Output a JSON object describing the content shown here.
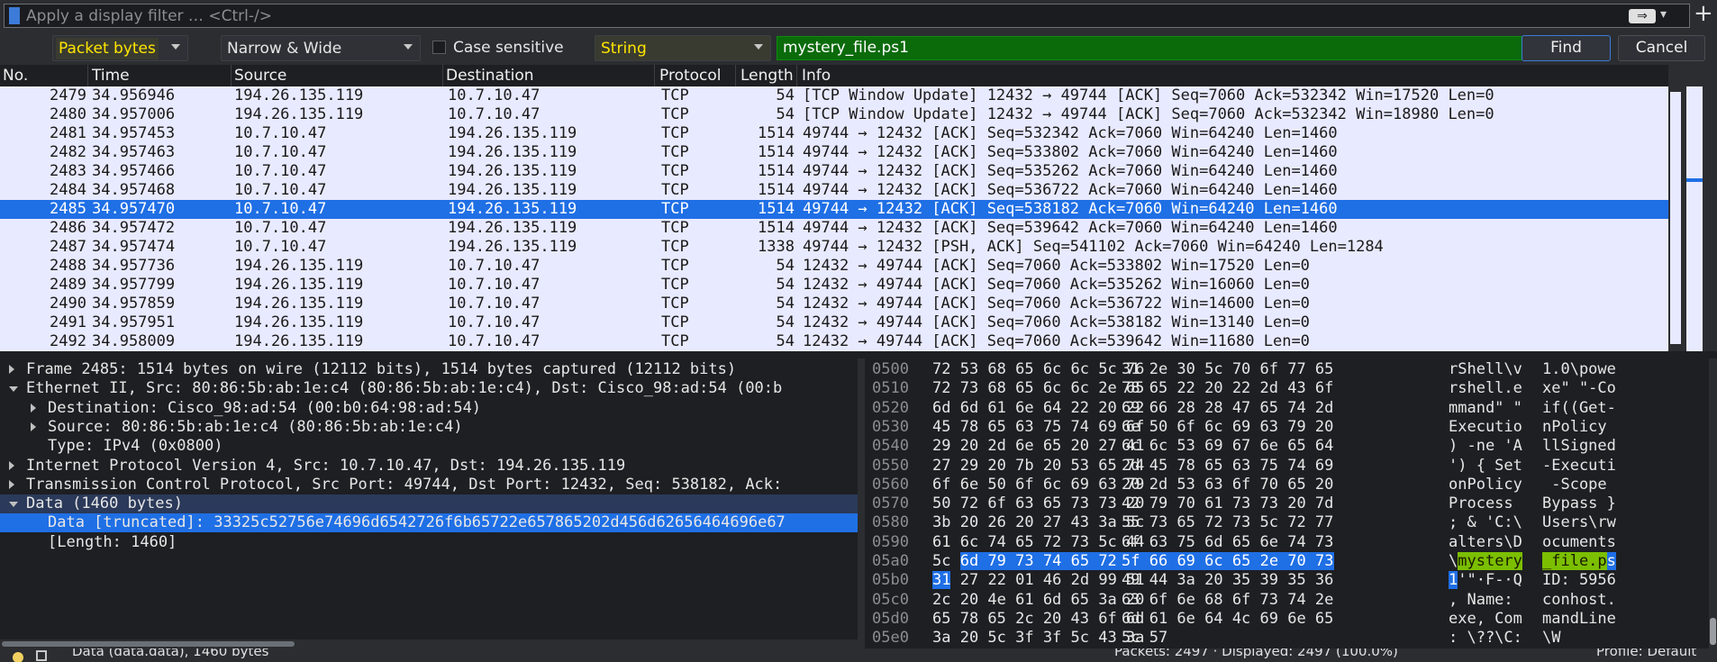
{
  "filter_bar": {
    "placeholder": "Apply a display filter … <Ctrl-/>",
    "apply_icon": "arrow-right-icon",
    "plus_label": "+"
  },
  "find_bar": {
    "search_in": "Packet bytes",
    "char_width": "Narrow & Wide",
    "case_sensitive_label": "Case sensitive",
    "case_sensitive_checked": false,
    "search_type": "String",
    "search_value": "mystery_file.ps1",
    "find_label": "Find",
    "cancel_label": "Cancel"
  },
  "packet_list": {
    "columns": [
      "No.",
      "Time",
      "Source",
      "Destination",
      "Protocol",
      "Length",
      "Info"
    ],
    "selected_index": 6,
    "rows": [
      {
        "no": "2479",
        "time": "34.956946",
        "src": "194.26.135.119",
        "dst": "10.7.10.47",
        "proto": "TCP",
        "len": "54",
        "info": "[TCP Window Update] 12432 → 49744 [ACK] Seq=7060 Ack=532342 Win=17520 Len=0"
      },
      {
        "no": "2480",
        "time": "34.957006",
        "src": "194.26.135.119",
        "dst": "10.7.10.47",
        "proto": "TCP",
        "len": "54",
        "info": "[TCP Window Update] 12432 → 49744 [ACK] Seq=7060 Ack=532342 Win=18980 Len=0"
      },
      {
        "no": "2481",
        "time": "34.957453",
        "src": "10.7.10.47",
        "dst": "194.26.135.119",
        "proto": "TCP",
        "len": "1514",
        "info": "49744 → 12432 [ACK] Seq=532342 Ack=7060 Win=64240 Len=1460"
      },
      {
        "no": "2482",
        "time": "34.957463",
        "src": "10.7.10.47",
        "dst": "194.26.135.119",
        "proto": "TCP",
        "len": "1514",
        "info": "49744 → 12432 [ACK] Seq=533802 Ack=7060 Win=64240 Len=1460"
      },
      {
        "no": "2483",
        "time": "34.957466",
        "src": "10.7.10.47",
        "dst": "194.26.135.119",
        "proto": "TCP",
        "len": "1514",
        "info": "49744 → 12432 [ACK] Seq=535262 Ack=7060 Win=64240 Len=1460"
      },
      {
        "no": "2484",
        "time": "34.957468",
        "src": "10.7.10.47",
        "dst": "194.26.135.119",
        "proto": "TCP",
        "len": "1514",
        "info": "49744 → 12432 [ACK] Seq=536722 Ack=7060 Win=64240 Len=1460"
      },
      {
        "no": "2485",
        "time": "34.957470",
        "src": "10.7.10.47",
        "dst": "194.26.135.119",
        "proto": "TCP",
        "len": "1514",
        "info": "49744 → 12432 [ACK] Seq=538182 Ack=7060 Win=64240 Len=1460"
      },
      {
        "no": "2486",
        "time": "34.957472",
        "src": "10.7.10.47",
        "dst": "194.26.135.119",
        "proto": "TCP",
        "len": "1514",
        "info": "49744 → 12432 [ACK] Seq=539642 Ack=7060 Win=64240 Len=1460"
      },
      {
        "no": "2487",
        "time": "34.957474",
        "src": "10.7.10.47",
        "dst": "194.26.135.119",
        "proto": "TCP",
        "len": "1338",
        "info": "49744 → 12432 [PSH, ACK] Seq=541102 Ack=7060 Win=64240 Len=1284"
      },
      {
        "no": "2488",
        "time": "34.957736",
        "src": "194.26.135.119",
        "dst": "10.7.10.47",
        "proto": "TCP",
        "len": "54",
        "info": "12432 → 49744 [ACK] Seq=7060 Ack=533802 Win=17520 Len=0"
      },
      {
        "no": "2489",
        "time": "34.957799",
        "src": "194.26.135.119",
        "dst": "10.7.10.47",
        "proto": "TCP",
        "len": "54",
        "info": "12432 → 49744 [ACK] Seq=7060 Ack=535262 Win=16060 Len=0"
      },
      {
        "no": "2490",
        "time": "34.957859",
        "src": "194.26.135.119",
        "dst": "10.7.10.47",
        "proto": "TCP",
        "len": "54",
        "info": "12432 → 49744 [ACK] Seq=7060 Ack=536722 Win=14600 Len=0"
      },
      {
        "no": "2491",
        "time": "34.957951",
        "src": "194.26.135.119",
        "dst": "10.7.10.47",
        "proto": "TCP",
        "len": "54",
        "info": "12432 → 49744 [ACK] Seq=7060 Ack=538182 Win=13140 Len=0"
      },
      {
        "no": "2492",
        "time": "34.958009",
        "src": "194.26.135.119",
        "dst": "10.7.10.47",
        "proto": "TCP",
        "len": "54",
        "info": "12432 → 49744 [ACK] Seq=7060 Ack=539642 Win=11680 Len=0"
      }
    ]
  },
  "details": {
    "rows": [
      {
        "indent": 0,
        "expander": "collapsed",
        "text": "Frame 2485: 1514 bytes on wire (12112 bits), 1514 bytes captured (12112 bits)",
        "state": ""
      },
      {
        "indent": 0,
        "expander": "expanded",
        "text": "Ethernet II, Src: 80:86:5b:ab:1e:c4 (80:86:5b:ab:1e:c4), Dst: Cisco_98:ad:54 (00:b",
        "state": ""
      },
      {
        "indent": 1,
        "expander": "collapsed",
        "text": "Destination: Cisco_98:ad:54 (00:b0:64:98:ad:54)",
        "state": ""
      },
      {
        "indent": 1,
        "expander": "collapsed",
        "text": "Source: 80:86:5b:ab:1e:c4 (80:86:5b:ab:1e:c4)",
        "state": ""
      },
      {
        "indent": 1,
        "expander": "none",
        "text": "Type: IPv4 (0x0800)",
        "state": ""
      },
      {
        "indent": 0,
        "expander": "collapsed",
        "text": "Internet Protocol Version 4, Src: 10.7.10.47, Dst: 194.26.135.119",
        "state": ""
      },
      {
        "indent": 0,
        "expander": "collapsed",
        "text": "Transmission Control Protocol, Src Port: 49744, Dst Port: 12432, Seq: 538182, Ack:",
        "state": ""
      },
      {
        "indent": 0,
        "expander": "expanded",
        "text": "Data (1460 bytes)",
        "state": "hl"
      },
      {
        "indent": 1,
        "expander": "none",
        "text": "Data [truncated]: 33325c52756e74696d6542726f6b65722e657865202d456d62656464696e67",
        "state": "sel"
      },
      {
        "indent": 1,
        "expander": "none",
        "text": "[Length: 1460]",
        "state": ""
      }
    ]
  },
  "bytes": {
    "rows": [
      {
        "off": "0500",
        "h1": "72 53 68 65 6c 6c 5c 76",
        "h2": "31 2e 30 5c 70 6f 77 65",
        "a1": "rShell\\v",
        "a2": "1.0\\powe"
      },
      {
        "off": "0510",
        "h1": "72 73 68 65 6c 6c 2e 65",
        "h2": "78 65 22 20 22 2d 43 6f",
        "a1": "rshell.e",
        "a2": "xe\" \"-Co"
      },
      {
        "off": "0520",
        "h1": "6d 6d 61 6e 64 22 20 22",
        "h2": "69 66 28 28 47 65 74 2d",
        "a1": "mmand\" \"",
        "a2": "if((Get-"
      },
      {
        "off": "0530",
        "h1": "45 78 65 63 75 74 69 6f",
        "h2": "6e 50 6f 6c 69 63 79 20",
        "a1": "Executio",
        "a2": "nPolicy "
      },
      {
        "off": "0540",
        "h1": "29 20 2d 6e 65 20 27 41",
        "h2": "6c 6c 53 69 67 6e 65 64",
        "a1": ") -ne 'A",
        "a2": "llSigned"
      },
      {
        "off": "0550",
        "h1": "27 29 20 7b 20 53 65 74",
        "h2": "2d 45 78 65 63 75 74 69",
        "a1": "') { Set",
        "a2": "-Executi"
      },
      {
        "off": "0560",
        "h1": "6f 6e 50 6f 6c 69 63 79",
        "h2": "20 2d 53 63 6f 70 65 20",
        "a1": "onPolicy",
        "a2": " -Scope "
      },
      {
        "off": "0570",
        "h1": "50 72 6f 63 65 73 73 20",
        "h2": "42 79 70 61 73 73 20 7d",
        "a1": "Process ",
        "a2": "Bypass }"
      },
      {
        "off": "0580",
        "h1": "3b 20 26 20 27 43 3a 5c",
        "h2": "55 73 65 72 73 5c 72 77",
        "a1": "; & 'C:\\",
        "a2": "Users\\rw"
      },
      {
        "off": "0590",
        "h1": "61 6c 74 65 72 73 5c 44",
        "h2": "6f 63 75 6d 65 6e 74 73",
        "a1": "alters\\D",
        "a2": "ocuments"
      },
      {
        "off": "05a0",
        "h1": "5c 6d 79 73 74 65 72 79",
        "h2": "5f 66 69 6c 65 2e 70 73",
        "a1": "\\mystery",
        "a2": "_file.ps"
      },
      {
        "off": "05b0",
        "h1": "31 27 22 01 46 2d 99 51",
        "h2": "49 44 3a 20 35 39 35 36",
        "a1": "1'\"·F-·Q",
        "a2": "ID: 5956"
      },
      {
        "off": "05c0",
        "h1": "2c 20 4e 61 6d 65 3a 20",
        "h2": "63 6f 6e 68 6f 73 74 2e",
        "a1": ", Name: ",
        "a2": "conhost."
      },
      {
        "off": "05d0",
        "h1": "65 78 65 2c 20 43 6f 6d",
        "h2": "6d 61 6e 64 4c 69 6e 65",
        "a1": "exe, Com",
        "a2": "mandLine"
      },
      {
        "off": "05e0",
        "h1": "3a 20 5c 3f 3f 5c 43 3a",
        "h2": "5c 57",
        "a1": ": \\??\\C:",
        "a2": "\\W"
      }
    ]
  },
  "status_bar": {
    "left_text": "Data (data.data), 1460 bytes",
    "packets_text": "Packets: 2497 · Displayed: 2497 (100.0%)",
    "profile_text": "Profile: Default"
  },
  "colors": {
    "selection": "#1f6fe5",
    "packet_bg": "#e8eaff",
    "search_match": "#7bbf00",
    "find_field_bg": "#0b6b0b"
  }
}
